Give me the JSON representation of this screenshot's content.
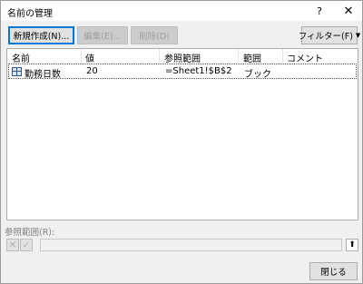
{
  "window": {
    "title": "名前の管理",
    "help_glyph": "?",
    "close_glyph": "✕"
  },
  "toolbar": {
    "new_label": "新規作成(N)...",
    "edit_label": "編集(E)...",
    "delete_label": "削除(D)",
    "filter_label": "フィルター(F)",
    "filter_caret": "▼"
  },
  "list": {
    "columns": [
      "名前",
      "値",
      "参照範囲",
      "範囲",
      "コメント"
    ],
    "rows": [
      {
        "name": "勤務日数",
        "value": "20",
        "refers_to": "=Sheet1!$B$2",
        "scope": "ブック",
        "comment": "",
        "icon": "named-range-icon"
      }
    ]
  },
  "reference": {
    "label": "参照範囲(R):",
    "value": "",
    "cancel_glyph": "✕",
    "ok_glyph": "✓",
    "collapse_glyph": "⬆"
  },
  "footer": {
    "close_label": "閉じる"
  }
}
